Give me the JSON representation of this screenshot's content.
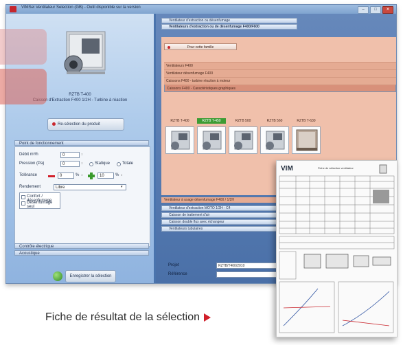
{
  "window": {
    "title": "VIMSel Ventilateur Selection (GB) - Outil disponible sur la version",
    "buttons": [
      "–",
      "□",
      "✕"
    ]
  },
  "left_panel": {
    "product_code": "RZTB T-400",
    "product_desc": "Caisson d'Extraction F400 1/2H - Turbine à réaction",
    "new_selection_label": "Re-sélection du produit",
    "point_section_label": "Point de fonctionnement",
    "fields": {
      "debit_label": "Débit m³/h",
      "debit_value": "0",
      "pression_label": "Pression (Pa)",
      "pression_value": "0",
      "statique_label": "Statique",
      "totale_label": "Totale",
      "tolerance_label": "Tolérance",
      "tol_minus": "0",
      "tol_plus": "10",
      "percent": "%",
      "rendement_label": "Rendement",
      "rendement_value": "Libre"
    },
    "options": [
      "Confort / désenfumage",
      "Désenfumage seul"
    ],
    "acc_labels": [
      "Contrôle électrique",
      "Acoustique"
    ],
    "save_label": "Enregistrer la sélection"
  },
  "right_panel": {
    "acc_top": [
      "Ventilateur d'extraction ou désenfumage",
      "Ventilateurs d'extraction ou de désenfumage F400/F600"
    ],
    "retour_label": "Pour cette famille",
    "categories": [
      "Ventilateurs F400",
      "Ventilateur désenfumage F400",
      "Caissons F400 - turbine réaction à moteur",
      "Caissons F400 - Caractéristiques graphiques"
    ],
    "models": [
      "RZTB T-400",
      "RZTB T-450",
      "RZTB 500",
      "RZTB 560",
      "RZTB T-630"
    ],
    "active_model_index": 1,
    "bottom_info": "Ventilateur à usage désenfumage F400 / 1/2H",
    "acc_bottom": [
      "Ventilateur d'extraction MOTO 1/2H - C4",
      "Caisson de traitement d'air",
      "Caisson double flux avec échangeur",
      "Ventilateurs tubulaires"
    ],
    "projet_label": "Projet",
    "projet_value": "RZTB/T400/2010",
    "reference_label": "Référence",
    "reference_value": ""
  },
  "document": {
    "logo_main": "VIM",
    "header_text": "Fiche de sélection ventilateur"
  },
  "caption": "Fiche de résultat de la sélection",
  "colors": {
    "accent_red": "#d11f2a",
    "active_green": "#3d9c34",
    "panel_salmon": "#f0c0ab",
    "app_blue": "#4a74ad"
  }
}
